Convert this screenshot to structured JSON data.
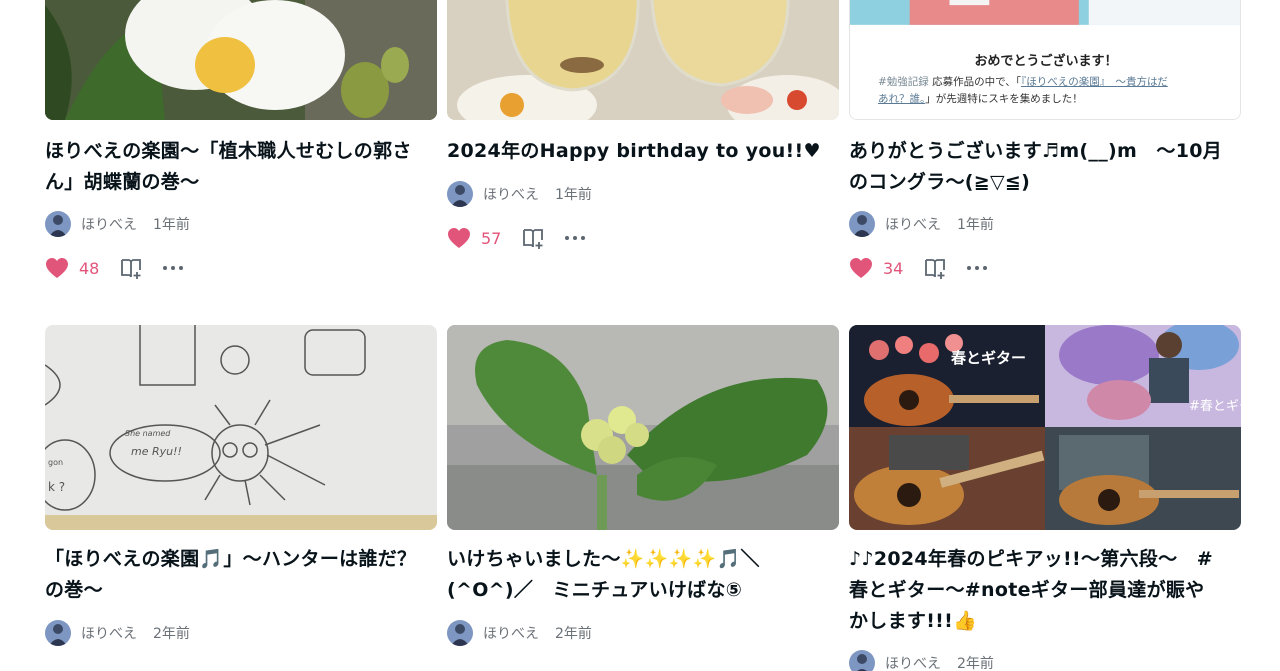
{
  "cards": [
    {
      "title_lines": [
        "ほりべえの楽園〜「植木職人せむしの郭さ",
        "ん」胡蝶蘭の巻〜"
      ],
      "author": "ほりべえ",
      "time": "1年前",
      "likes": "48"
    },
    {
      "title_lines": [
        "2024年のHappy birthday to you!!♥"
      ],
      "author": "ほりべえ",
      "time": "1年前",
      "likes": "57"
    },
    {
      "title_lines": [
        "ありがとうございます♬m(__)m　〜10月",
        "のコングラ〜(≧▽≦)"
      ],
      "author": "ほりべえ",
      "time": "1年前",
      "likes": "34",
      "thumb_text": {
        "heading": "おめでとうございます！",
        "line1_tag": "#勉強記録",
        "line1_text": "応募作品の中で、「",
        "line1_link": "『ほりべえの楽園』　〜貴方はだ",
        "line2_link": "あれ？誰。",
        "line2_text": "」が先週特にスキを集めました！"
      }
    },
    {
      "title_lines": [
        "「ほりべえの楽園🎵」〜ハンターは誰だ？",
        "の巻〜"
      ],
      "author": "ほりべえ",
      "time": "2年前",
      "likes": "",
      "thumb_text": {
        "bubble1": "She named",
        "bubble2": "me Ryu!!",
        "side1": "gon",
        "side2": "k ?"
      }
    },
    {
      "title_lines": [
        "いけちゃいました〜✨✨✨✨🎵＼",
        "(^O^)／　ミニチュアいけばな⑤"
      ],
      "author": "ほりべえ",
      "time": "2年前",
      "likes": ""
    },
    {
      "title_lines": [
        "♪♪2024年春のピキアッ!!〜第六段〜　#",
        "春とギター〜#noteギター部員達が賑や",
        "かします!!!👍"
      ],
      "author": "ほりべえ",
      "time": "2年前",
      "likes": "",
      "thumb_text": {
        "overlay1": "春とギター",
        "overlay2": "#春とギタ"
      }
    }
  ],
  "colors": {
    "like": "#e2557a",
    "meta": "#6a7177",
    "title": "#08131a"
  },
  "icons": {
    "like": "heart-icon",
    "bookmark": "bookmark-add-icon",
    "more": "more-dots-icon"
  }
}
